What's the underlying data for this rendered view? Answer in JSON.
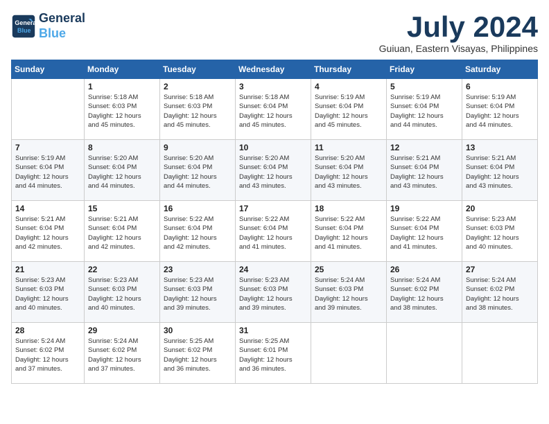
{
  "logo": {
    "line1": "General",
    "line2": "Blue"
  },
  "title": "July 2024",
  "location": "Guiuan, Eastern Visayas, Philippines",
  "days_of_week": [
    "Sunday",
    "Monday",
    "Tuesday",
    "Wednesday",
    "Thursday",
    "Friday",
    "Saturday"
  ],
  "weeks": [
    [
      {
        "num": "",
        "info": ""
      },
      {
        "num": "1",
        "info": "Sunrise: 5:18 AM\nSunset: 6:03 PM\nDaylight: 12 hours\nand 45 minutes."
      },
      {
        "num": "2",
        "info": "Sunrise: 5:18 AM\nSunset: 6:03 PM\nDaylight: 12 hours\nand 45 minutes."
      },
      {
        "num": "3",
        "info": "Sunrise: 5:18 AM\nSunset: 6:04 PM\nDaylight: 12 hours\nand 45 minutes."
      },
      {
        "num": "4",
        "info": "Sunrise: 5:19 AM\nSunset: 6:04 PM\nDaylight: 12 hours\nand 45 minutes."
      },
      {
        "num": "5",
        "info": "Sunrise: 5:19 AM\nSunset: 6:04 PM\nDaylight: 12 hours\nand 44 minutes."
      },
      {
        "num": "6",
        "info": "Sunrise: 5:19 AM\nSunset: 6:04 PM\nDaylight: 12 hours\nand 44 minutes."
      }
    ],
    [
      {
        "num": "7",
        "info": "Sunrise: 5:19 AM\nSunset: 6:04 PM\nDaylight: 12 hours\nand 44 minutes."
      },
      {
        "num": "8",
        "info": "Sunrise: 5:20 AM\nSunset: 6:04 PM\nDaylight: 12 hours\nand 44 minutes."
      },
      {
        "num": "9",
        "info": "Sunrise: 5:20 AM\nSunset: 6:04 PM\nDaylight: 12 hours\nand 44 minutes."
      },
      {
        "num": "10",
        "info": "Sunrise: 5:20 AM\nSunset: 6:04 PM\nDaylight: 12 hours\nand 43 minutes."
      },
      {
        "num": "11",
        "info": "Sunrise: 5:20 AM\nSunset: 6:04 PM\nDaylight: 12 hours\nand 43 minutes."
      },
      {
        "num": "12",
        "info": "Sunrise: 5:21 AM\nSunset: 6:04 PM\nDaylight: 12 hours\nand 43 minutes."
      },
      {
        "num": "13",
        "info": "Sunrise: 5:21 AM\nSunset: 6:04 PM\nDaylight: 12 hours\nand 43 minutes."
      }
    ],
    [
      {
        "num": "14",
        "info": "Sunrise: 5:21 AM\nSunset: 6:04 PM\nDaylight: 12 hours\nand 42 minutes."
      },
      {
        "num": "15",
        "info": "Sunrise: 5:21 AM\nSunset: 6:04 PM\nDaylight: 12 hours\nand 42 minutes."
      },
      {
        "num": "16",
        "info": "Sunrise: 5:22 AM\nSunset: 6:04 PM\nDaylight: 12 hours\nand 42 minutes."
      },
      {
        "num": "17",
        "info": "Sunrise: 5:22 AM\nSunset: 6:04 PM\nDaylight: 12 hours\nand 41 minutes."
      },
      {
        "num": "18",
        "info": "Sunrise: 5:22 AM\nSunset: 6:04 PM\nDaylight: 12 hours\nand 41 minutes."
      },
      {
        "num": "19",
        "info": "Sunrise: 5:22 AM\nSunset: 6:04 PM\nDaylight: 12 hours\nand 41 minutes."
      },
      {
        "num": "20",
        "info": "Sunrise: 5:23 AM\nSunset: 6:03 PM\nDaylight: 12 hours\nand 40 minutes."
      }
    ],
    [
      {
        "num": "21",
        "info": "Sunrise: 5:23 AM\nSunset: 6:03 PM\nDaylight: 12 hours\nand 40 minutes."
      },
      {
        "num": "22",
        "info": "Sunrise: 5:23 AM\nSunset: 6:03 PM\nDaylight: 12 hours\nand 40 minutes."
      },
      {
        "num": "23",
        "info": "Sunrise: 5:23 AM\nSunset: 6:03 PM\nDaylight: 12 hours\nand 39 minutes."
      },
      {
        "num": "24",
        "info": "Sunrise: 5:23 AM\nSunset: 6:03 PM\nDaylight: 12 hours\nand 39 minutes."
      },
      {
        "num": "25",
        "info": "Sunrise: 5:24 AM\nSunset: 6:03 PM\nDaylight: 12 hours\nand 39 minutes."
      },
      {
        "num": "26",
        "info": "Sunrise: 5:24 AM\nSunset: 6:02 PM\nDaylight: 12 hours\nand 38 minutes."
      },
      {
        "num": "27",
        "info": "Sunrise: 5:24 AM\nSunset: 6:02 PM\nDaylight: 12 hours\nand 38 minutes."
      }
    ],
    [
      {
        "num": "28",
        "info": "Sunrise: 5:24 AM\nSunset: 6:02 PM\nDaylight: 12 hours\nand 37 minutes."
      },
      {
        "num": "29",
        "info": "Sunrise: 5:24 AM\nSunset: 6:02 PM\nDaylight: 12 hours\nand 37 minutes."
      },
      {
        "num": "30",
        "info": "Sunrise: 5:25 AM\nSunset: 6:02 PM\nDaylight: 12 hours\nand 36 minutes."
      },
      {
        "num": "31",
        "info": "Sunrise: 5:25 AM\nSunset: 6:01 PM\nDaylight: 12 hours\nand 36 minutes."
      },
      {
        "num": "",
        "info": ""
      },
      {
        "num": "",
        "info": ""
      },
      {
        "num": "",
        "info": ""
      }
    ]
  ]
}
